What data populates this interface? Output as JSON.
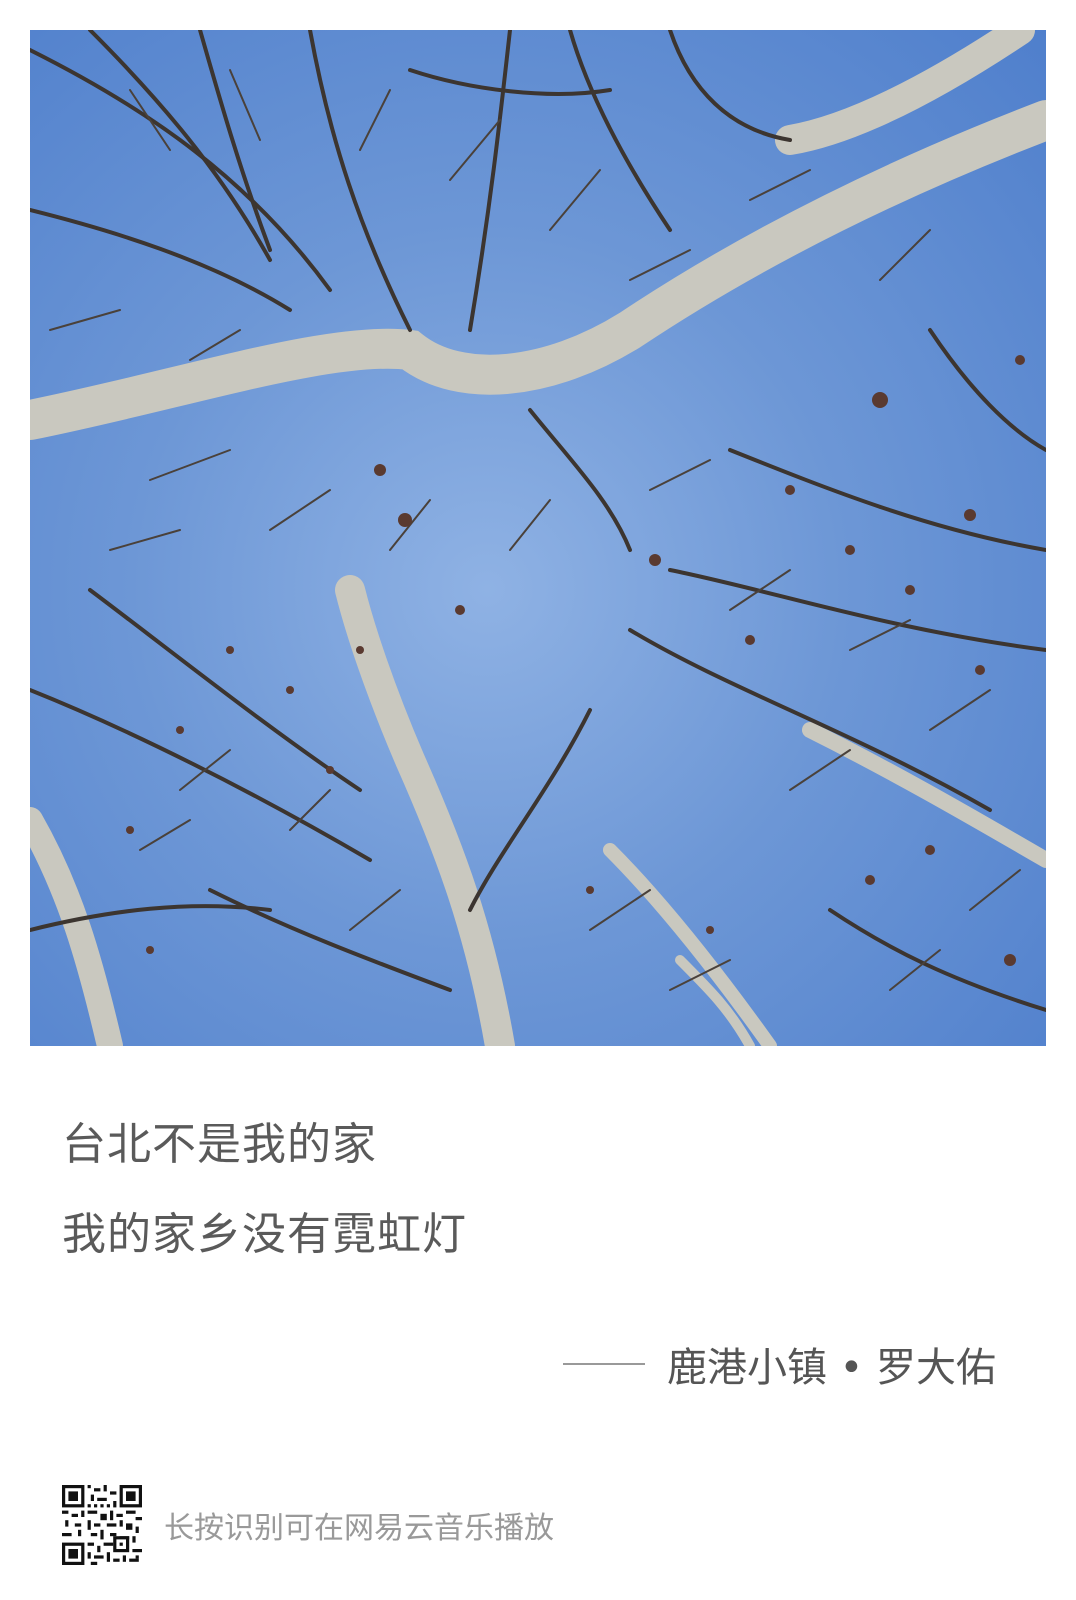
{
  "lyrics": {
    "line1": "台北不是我的家",
    "line2": "我的家乡没有霓虹灯"
  },
  "credit": {
    "text": "鹿港小镇 • 罗大佑"
  },
  "footer": {
    "hint": "长按识别可在网易云音乐播放",
    "qr_icon": "qr-code-icon"
  },
  "colors": {
    "sky": "#6d97d6",
    "lyric_text": "#5a5a5a",
    "hint_text": "#999999"
  }
}
